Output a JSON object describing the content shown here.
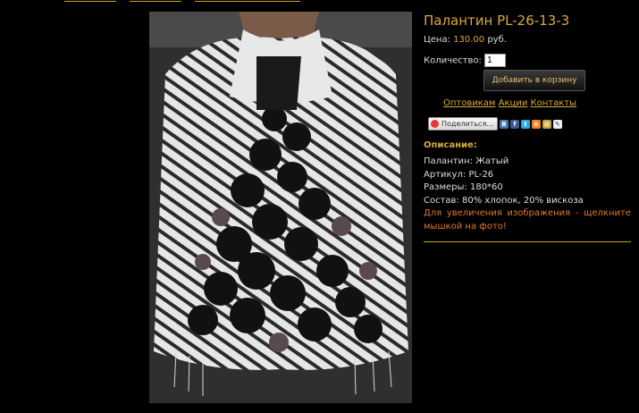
{
  "product": {
    "title": "Палантин PL-26-13-3",
    "price_label": "Цена:",
    "price_value": "130.00",
    "price_currency": "руб.",
    "qty_label": "Количество:",
    "qty_value": "1",
    "cart_button": "Добавить в корзину"
  },
  "links": {
    "wholesale": "Оптовикам",
    "sales": "Акции",
    "contacts": "Контакты"
  },
  "share": {
    "button": "Поделиться...",
    "icons": [
      "vkontakte-icon",
      "facebook-icon",
      "twitter-icon",
      "odnoklassniki-icon",
      "mailru-icon",
      "livejournal-icon"
    ]
  },
  "description": {
    "heading": "Описание:",
    "lines": [
      "Палантин: Жатый",
      "Артикул: PL-26",
      "Размеры: 180*60",
      "Состав: 80% хлопок, 20% вискоза"
    ],
    "note": "Для увеличения изображения - щелкните мышкой на фото!"
  },
  "colors": {
    "accent": "#d9a93a",
    "note": "#e0782e",
    "background": "#000000"
  }
}
